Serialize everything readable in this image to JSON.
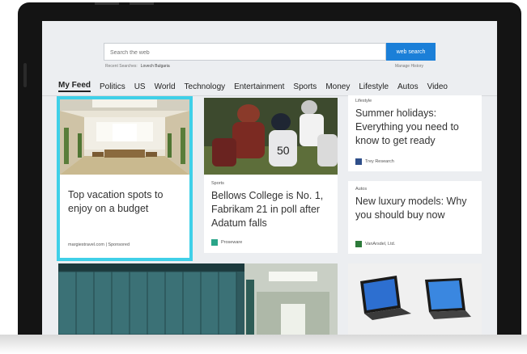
{
  "search": {
    "placeholder": "Search the web",
    "button": "web search",
    "recent_label": "Recent Searches:",
    "recent_value": "Lovech Bulgaria",
    "manage": "Manage History"
  },
  "nav": [
    "My Feed",
    "Politics",
    "US",
    "World",
    "Technology",
    "Entertainment",
    "Sports",
    "Money",
    "Lifestyle",
    "Autos",
    "Video"
  ],
  "cards": {
    "vacation": {
      "title": "Top vacation spots to enjoy on a budget",
      "source": "margiestravel.com | Sponsored"
    },
    "sports": {
      "category": "Sports",
      "title": "Bellows College is No. 1, Fabrikam 21 in poll after Adatum falls",
      "source": "Proseware"
    },
    "lifestyle": {
      "category": "Lifestyle",
      "title": "Summer holidays: Everything you need to know to get ready",
      "source": "Trey Research"
    },
    "autos": {
      "category": "Autos",
      "title": "New luxury models: Why you should buy now",
      "source": "VanArsdel, Ltd."
    }
  },
  "colors": {
    "accent": "#1b7fd8",
    "selection": "#3fd0e8"
  }
}
